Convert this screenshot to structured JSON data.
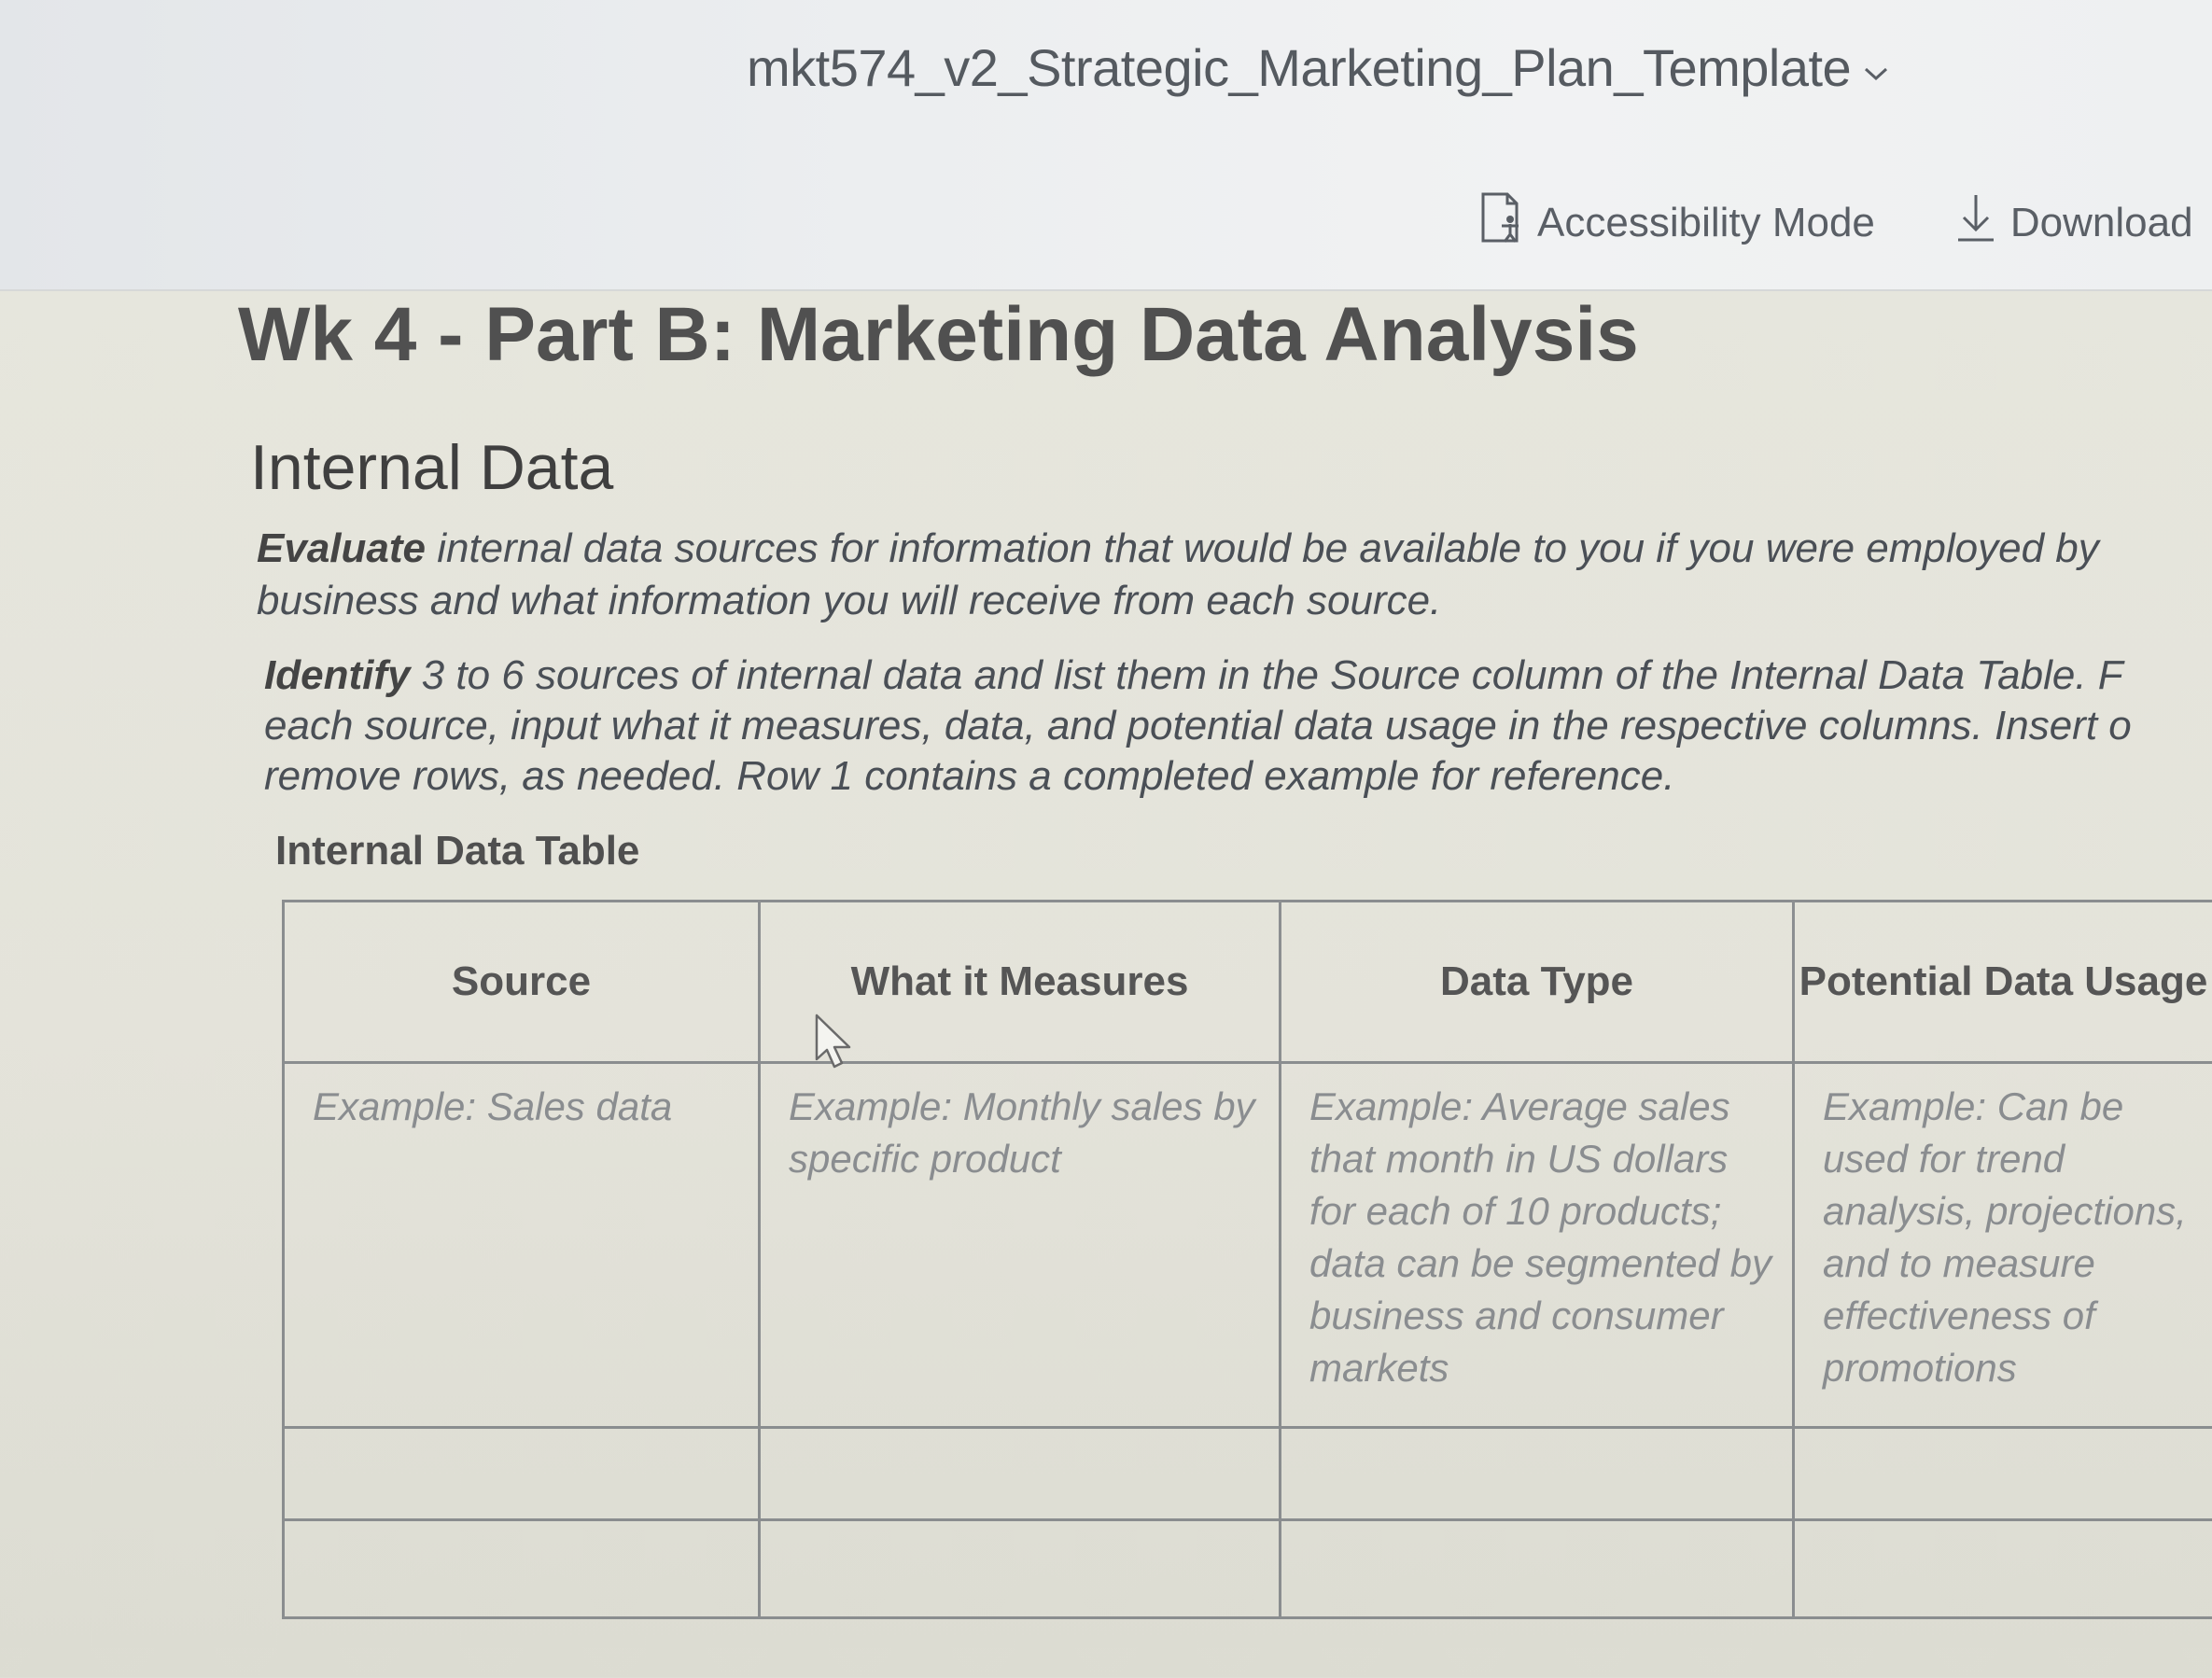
{
  "header": {
    "doc_title": "mkt574_v2_Strategic_Marketing_Plan_Template",
    "accessibility_label": "Accessibility Mode",
    "download_label": "Download"
  },
  "document": {
    "heading": "Wk 4 - Part B: Marketing Data Analysis",
    "section_heading": "Internal Data",
    "evaluate_lead": "Evaluate",
    "evaluate_text_1": " internal data sources for information that would be available to you if you were employed by",
    "evaluate_text_2": "business and what information you will receive from each source.",
    "identify_lead": "Identify",
    "identify_text_1": " 3 to 6 sources of internal data and list them in the Source column of the Internal Data Table. F",
    "identify_text_2": "each source, input what it measures, data, and potential data usage in the respective columns. Insert o",
    "identify_text_3": "remove rows, as needed. Row 1 contains a completed example for reference.",
    "table_caption": "Internal Data Table"
  },
  "table": {
    "headers": [
      "Source",
      "What it Measures",
      "Data Type",
      "Potential Data Usage"
    ],
    "example_row": [
      "Example: Sales data",
      "Example: Monthly sales by specific product",
      "Example: Average sales that month in US dollars for each of 10 products; data can be segmented by business and consumer markets",
      "Example: Can be used for trend analysis, projections, and to measure effectiveness of promotions"
    ]
  },
  "icons": {
    "title_chevron": "chevron-down-icon",
    "accessibility": "accessibility-document-icon",
    "download": "download-arrow-icon",
    "cursor": "mouse-pointer-icon"
  }
}
